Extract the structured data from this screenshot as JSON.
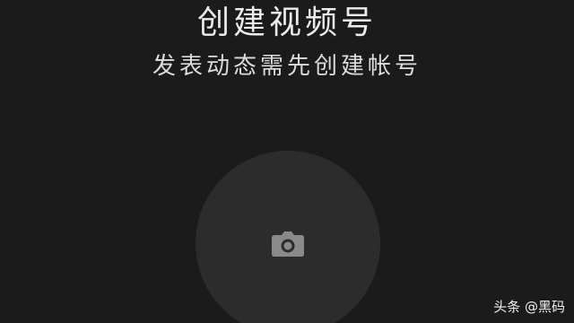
{
  "header": {
    "title": "创建视频号",
    "subtitle": "发表动态需先创建帐号"
  },
  "avatar": {
    "icon": "camera-icon",
    "background_color": "#2c2c2c",
    "icon_color": "#8a8a8a"
  },
  "watermark": {
    "text": "头条 @黑码"
  },
  "colors": {
    "background": "#1b1b1b",
    "text": "#ececec"
  }
}
